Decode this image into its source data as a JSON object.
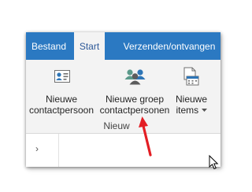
{
  "tabs": [
    {
      "label": "Bestand"
    },
    {
      "label": "Start"
    },
    {
      "label": "Verzenden/ontvangen"
    }
  ],
  "ribbon": {
    "group_label": "Nieuw",
    "new_contact": {
      "line1": "Nieuwe",
      "line2": "contactpersoon",
      "icon": "contact-card-icon"
    },
    "new_group": {
      "line1": "Nieuwe groep",
      "line2": "contactpersonen",
      "icon": "contact-group-icon"
    },
    "new_items": {
      "line1": "Nieuwe",
      "line2": "items",
      "icon": "new-items-icon"
    }
  },
  "navigation": {
    "expand_glyph": "›"
  },
  "colors": {
    "accent": "#2b79c2",
    "ribbon_bg": "#f3f3f3",
    "annotation_arrow": "#e31e24"
  }
}
